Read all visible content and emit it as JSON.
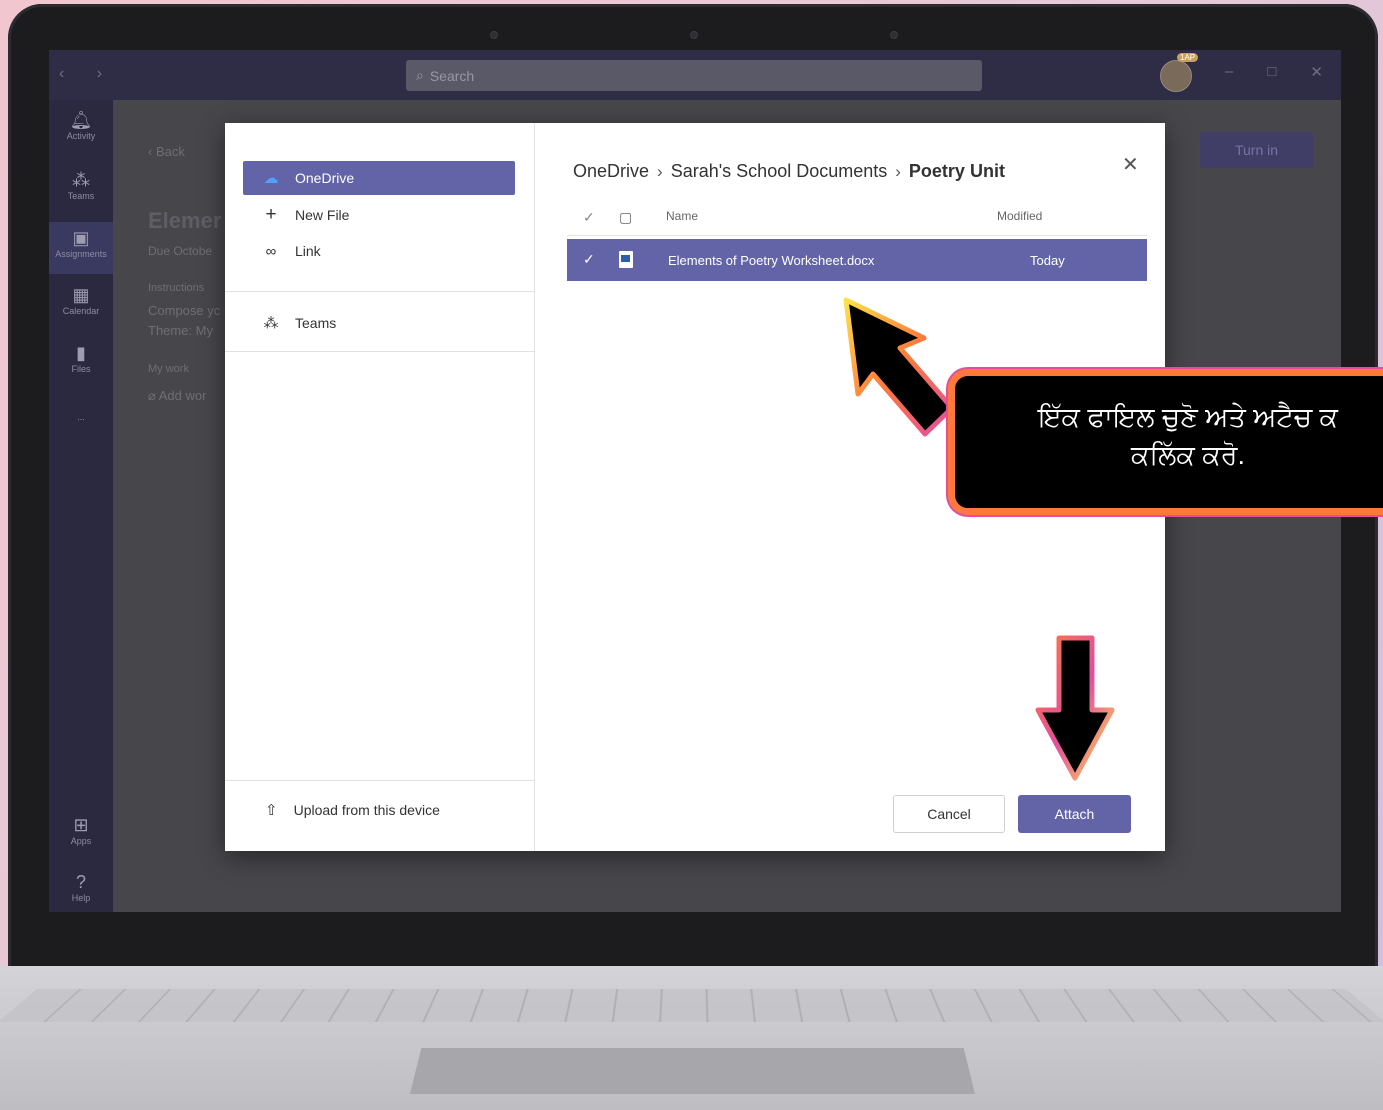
{
  "app": {
    "search_placeholder": "Search",
    "avatar_badge": "1AP",
    "back_label": "Back",
    "turn_in_label": "Turn in",
    "rail": [
      {
        "label": "Activity",
        "icon": "bell-icon"
      },
      {
        "label": "Teams",
        "icon": "teams-icon"
      },
      {
        "label": "Assignments",
        "icon": "assignments-icon"
      },
      {
        "label": "Calendar",
        "icon": "calendar-icon"
      },
      {
        "label": "Files",
        "icon": "files-icon"
      },
      {
        "label": "...",
        "icon": "more-icon"
      },
      {
        "label": "Apps",
        "icon": "apps-icon"
      },
      {
        "label": "Help",
        "icon": "help-icon"
      }
    ],
    "background": {
      "title": "Elemer",
      "due": "Due Octobe",
      "instructions_label": "Instructions",
      "instructions_line1": "Compose yc",
      "instructions_line2": "Theme: My",
      "my_work": "My work",
      "add_work": "Add wor"
    }
  },
  "dialog": {
    "nav": {
      "onedrive": "OneDrive",
      "new_file": "New File",
      "link": "Link",
      "teams": "Teams",
      "upload": "Upload from this device"
    },
    "breadcrumb": [
      "OneDrive",
      "Sarah's School Documents",
      "Poetry Unit"
    ],
    "columns": {
      "name": "Name",
      "modified": "Modified"
    },
    "files": [
      {
        "name": "Elements of Poetry Worksheet.docx",
        "modified": "Today",
        "selected": true
      }
    ],
    "cancel_label": "Cancel",
    "attach_label": "Attach"
  },
  "callout": {
    "text": "ਇੱਕ ਫਾਇਲ ਚੁਣੋ ਅਤੇ ਅਟੈਚ ਕ\nਕਲਿੱਕ ਕਰੋ."
  },
  "colors": {
    "accent": "#6264a7",
    "arrow_orange": "#ff7a3a",
    "arrow_yellow": "#ffe14a",
    "arrow_pink": "#e24da0"
  }
}
